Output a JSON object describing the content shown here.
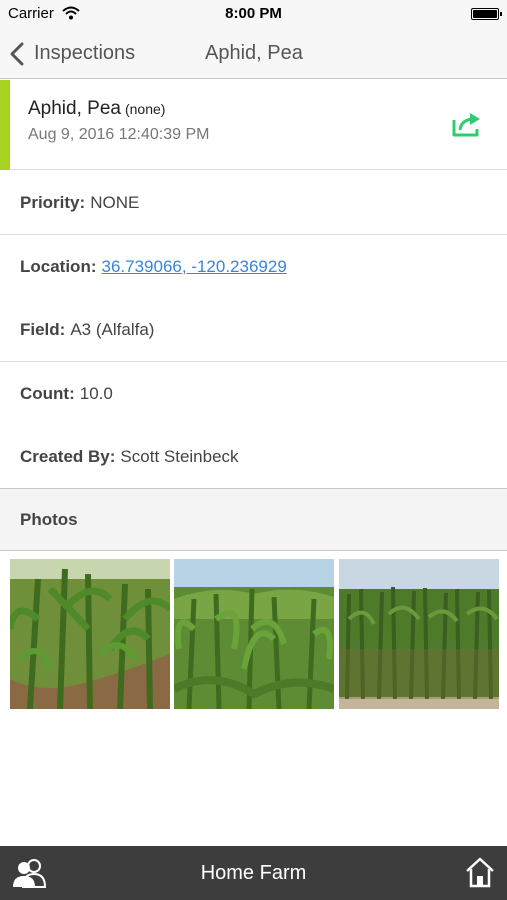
{
  "status_bar": {
    "carrier": "Carrier",
    "time": "8:00 PM"
  },
  "nav": {
    "back_label": "Inspections",
    "title": "Aphid, Pea"
  },
  "header": {
    "pest_name": "Aphid, Pea",
    "pest_note": "(none)",
    "date": "Aug 9, 2016 12:40:39 PM",
    "accent_color": "#a9d11f",
    "share_icon": "share-icon"
  },
  "details": {
    "priority": {
      "label": "Priority:",
      "value": "NONE"
    },
    "location": {
      "label": "Location:",
      "value": "36.739066, -120.236929"
    },
    "field": {
      "label": "Field:",
      "value": "A3 (Alfalfa)"
    },
    "count": {
      "label": "Count:",
      "value": "10.0"
    },
    "created_by": {
      "label": "Created By:",
      "value": "Scott Steinbeck"
    }
  },
  "photos": {
    "heading": "Photos",
    "count": 3
  },
  "tab_bar": {
    "title": "Home Farm",
    "left_icon": "people-icon",
    "right_icon": "home-icon"
  },
  "colors": {
    "link": "#3a85d8",
    "accent": "#a9d11f",
    "share": "#2ecc71",
    "tab_bar": "#3d3d3d"
  }
}
